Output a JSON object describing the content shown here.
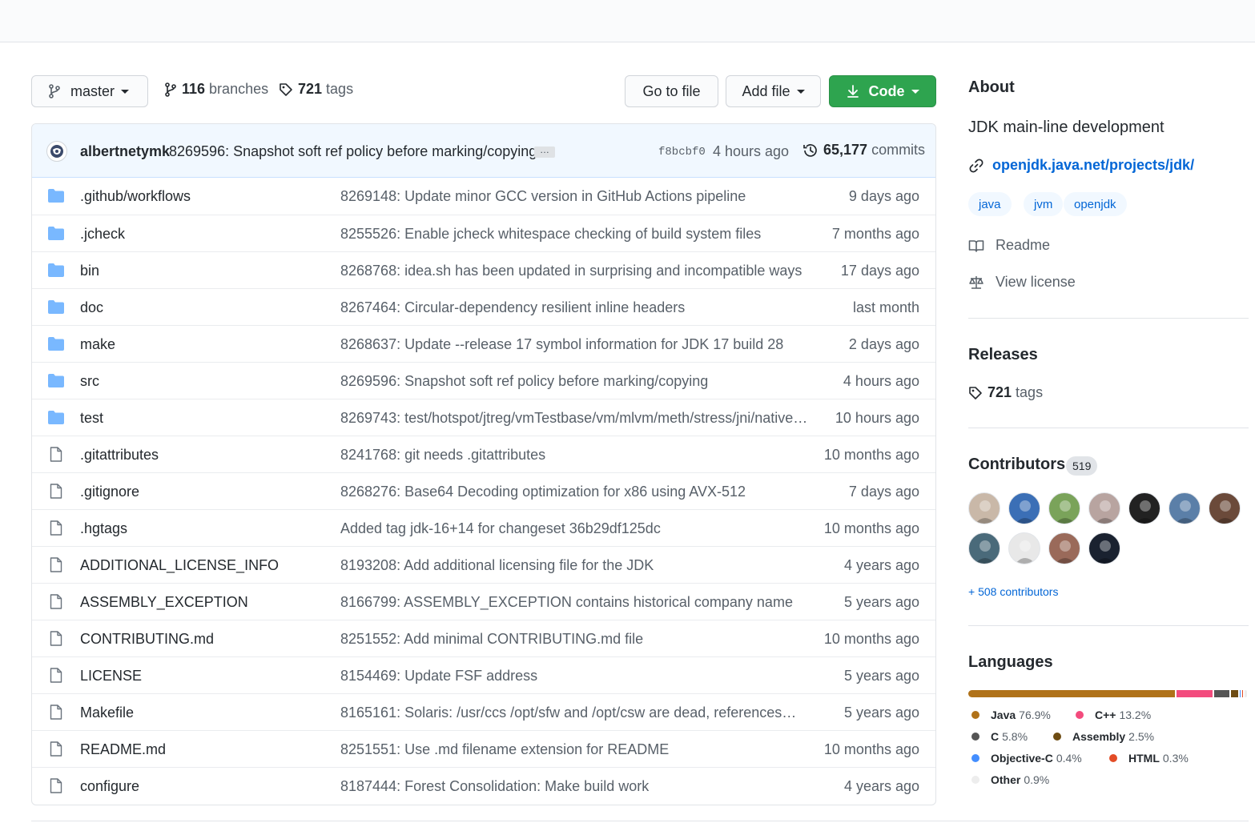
{
  "toolbar": {
    "branch": "master",
    "branches_count": "116",
    "branches_label": "branches",
    "tags_count": "721",
    "tags_label": "tags",
    "goto_label": "Go to file",
    "addfile_label": "Add file",
    "code_label": "Code"
  },
  "latest_commit": {
    "author": "albertnetymk",
    "message": "8269596: Snapshot soft ref policy before marking/copying",
    "ellipsis": "…",
    "sha": "f8bcbf0",
    "ago": "4 hours ago",
    "commits_count": "65,177",
    "commits_label": "commits"
  },
  "files": [
    {
      "name": ".github/workflows",
      "type": "folder",
      "message": "8269148: Update minor GCC version in GitHub Actions pipeline",
      "age": "9 days ago"
    },
    {
      "name": ".jcheck",
      "type": "folder",
      "message": "8255526: Enable jcheck whitespace checking of build system files",
      "age": "7 months ago"
    },
    {
      "name": "bin",
      "type": "folder",
      "message": "8268768: idea.sh has been updated in surprising and incompatible ways",
      "age": "17 days ago"
    },
    {
      "name": "doc",
      "type": "folder",
      "message": "8267464: Circular-dependency resilient inline headers",
      "age": "last month"
    },
    {
      "name": "make",
      "type": "folder",
      "message": "8268637: Update --release 17 symbol information for JDK 17 build 28",
      "age": "2 days ago"
    },
    {
      "name": "src",
      "type": "folder",
      "message": "8269596: Snapshot soft ref policy before marking/copying",
      "age": "4 hours ago"
    },
    {
      "name": "test",
      "type": "folder",
      "message": "8269743: test/hotspot/jtreg/vmTestbase/vm/mlvm/meth/stress/jni/native…",
      "age": "10 hours ago"
    },
    {
      "name": ".gitattributes",
      "type": "file",
      "message": "8241768: git needs .gitattributes",
      "age": "10 months ago"
    },
    {
      "name": ".gitignore",
      "type": "file",
      "message": "8268276: Base64 Decoding optimization for x86 using AVX-512",
      "age": "7 days ago"
    },
    {
      "name": ".hgtags",
      "type": "file",
      "message": "Added tag jdk-16+14 for changeset 36b29df125dc",
      "age": "10 months ago"
    },
    {
      "name": "ADDITIONAL_LICENSE_INFO",
      "type": "file",
      "message": "8193208: Add additional licensing file for the JDK",
      "age": "4 years ago"
    },
    {
      "name": "ASSEMBLY_EXCEPTION",
      "type": "file",
      "message": "8166799: ASSEMBLY_EXCEPTION contains historical company name",
      "age": "5 years ago"
    },
    {
      "name": "CONTRIBUTING.md",
      "type": "file",
      "message": "8251552: Add minimal CONTRIBUTING.md file",
      "age": "10 months ago"
    },
    {
      "name": "LICENSE",
      "type": "file",
      "message": "8154469: Update FSF address",
      "age": "5 years ago"
    },
    {
      "name": "Makefile",
      "type": "file",
      "message": "8165161: Solaris: /usr/ccs /opt/sfw and /opt/csw are dead, references…",
      "age": "5 years ago"
    },
    {
      "name": "README.md",
      "type": "file",
      "message": "8251551: Use .md filename extension for README",
      "age": "10 months ago"
    },
    {
      "name": "configure",
      "type": "file",
      "message": "8187444: Forest Consolidation: Make build work",
      "age": "4 years ago"
    }
  ],
  "about": {
    "heading": "About",
    "description": "JDK main-line development",
    "website": "openjdk.java.net/projects/jdk/",
    "topics": [
      "java",
      "jvm",
      "openjdk"
    ],
    "readme": "Readme",
    "license": "View license"
  },
  "releases": {
    "heading": "Releases",
    "tags_count": "721",
    "tags_label": "tags"
  },
  "contributors": {
    "heading": "Contributors",
    "count": "519",
    "more": "+ 508 contributors",
    "avatar_colors": [
      "#c9b8a8",
      "#3b6fb6",
      "#7aa35a",
      "#b8a4a0",
      "#222222",
      "#5b7fa8",
      "#6b4a3a",
      "#4a6a7a",
      "#e8e8e8",
      "#9a6a5a",
      "#1a2230"
    ]
  },
  "languages": {
    "heading": "Languages",
    "items": [
      {
        "name": "Java",
        "percent": "76.9%",
        "value": 76.9,
        "color": "#b07219"
      },
      {
        "name": "C++",
        "percent": "13.2%",
        "value": 13.2,
        "color": "#f34b7d"
      },
      {
        "name": "C",
        "percent": "5.8%",
        "value": 5.8,
        "color": "#555555"
      },
      {
        "name": "Assembly",
        "percent": "2.5%",
        "value": 2.5,
        "color": "#6e4c13"
      },
      {
        "name": "Objective-C",
        "percent": "0.4%",
        "value": 0.4,
        "color": "#438eff"
      },
      {
        "name": "HTML",
        "percent": "0.3%",
        "value": 0.3,
        "color": "#e34c26"
      },
      {
        "name": "Other",
        "percent": "0.9%",
        "value": 0.9,
        "color": "#ededed"
      }
    ]
  }
}
